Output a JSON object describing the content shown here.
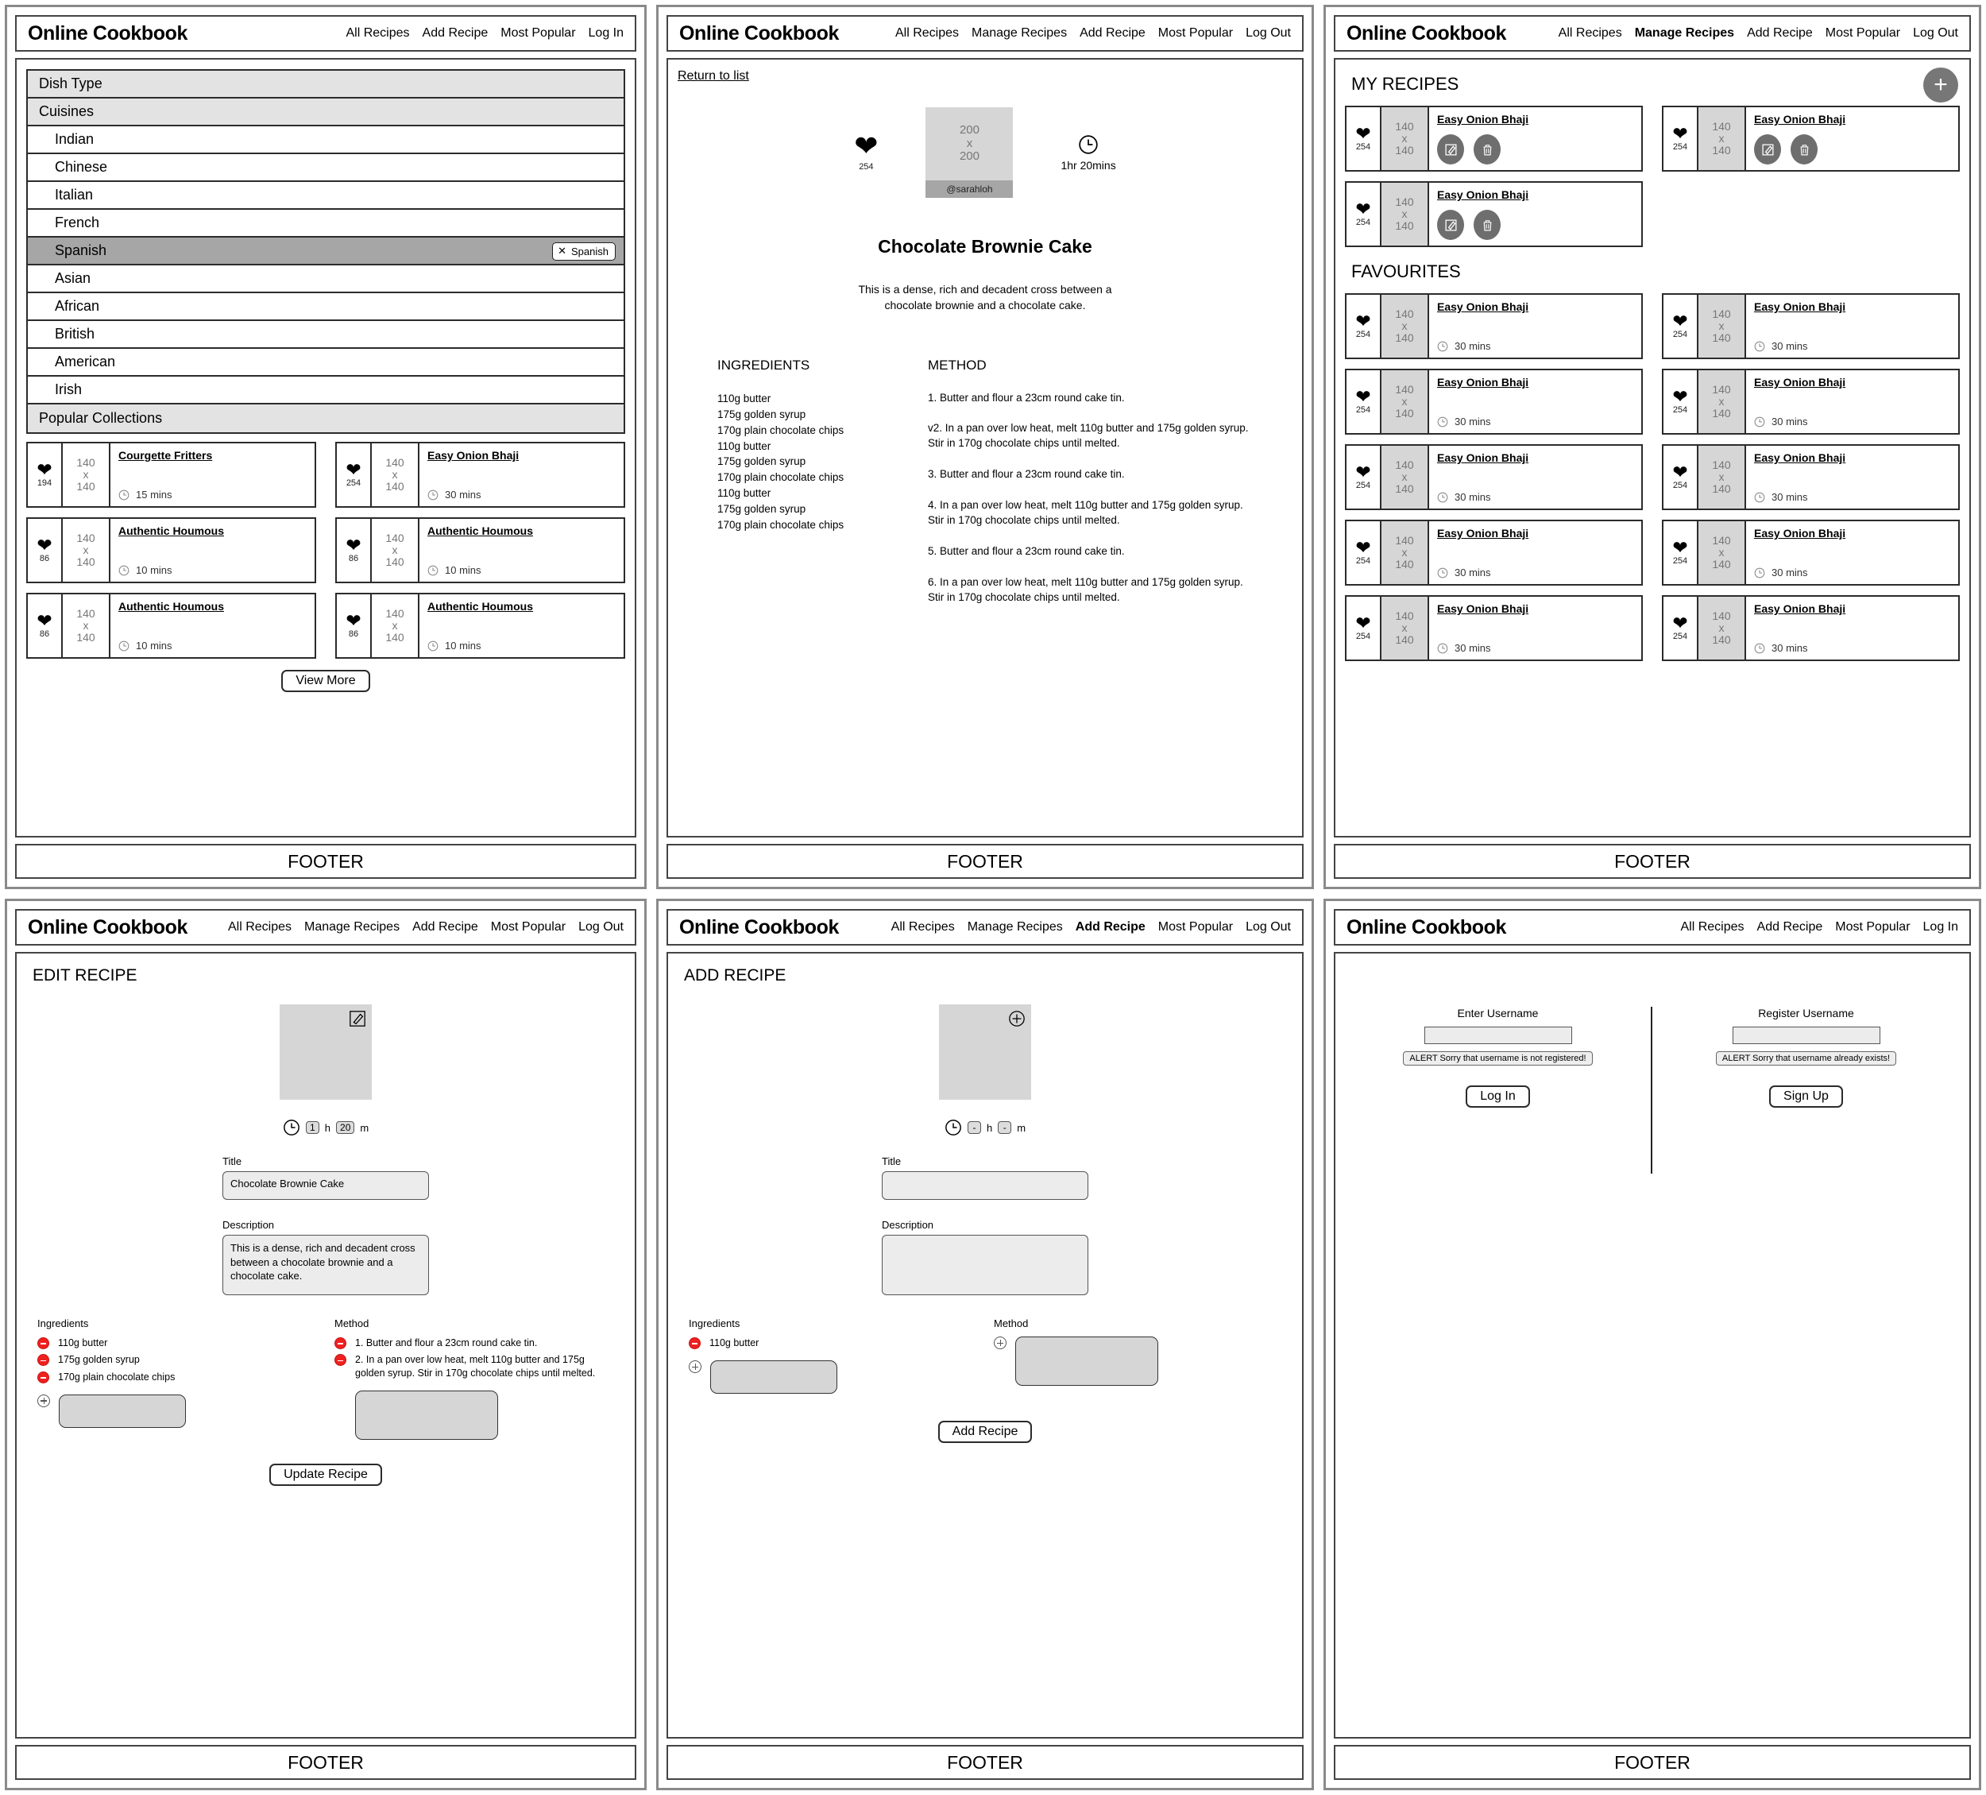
{
  "brand": "Online Cookbook",
  "footer_label": "FOOTER",
  "nav": {
    "logged_out": [
      "All Recipes",
      "Add Recipe",
      "Most Popular",
      "Log In"
    ],
    "logged_in": [
      "All Recipes",
      "Manage Recipes",
      "Add Recipe",
      "Most Popular",
      "Log Out"
    ]
  },
  "panel1": {
    "accordion": [
      {
        "label": "Dish Type",
        "type": "group"
      },
      {
        "label": "Cuisines",
        "type": "group"
      },
      {
        "label": "Indian",
        "type": "child"
      },
      {
        "label": "Chinese",
        "type": "child"
      },
      {
        "label": "Italian",
        "type": "child"
      },
      {
        "label": "French",
        "type": "child"
      },
      {
        "label": "Spanish",
        "type": "child",
        "selected": true,
        "chip": "Spanish",
        "chip_x": "✕"
      },
      {
        "label": "Asian",
        "type": "child"
      },
      {
        "label": "African",
        "type": "child"
      },
      {
        "label": "British",
        "type": "child"
      },
      {
        "label": "American",
        "type": "child"
      },
      {
        "label": "Irish",
        "type": "child"
      },
      {
        "label": "Popular Collections",
        "type": "group"
      }
    ],
    "cards": [
      {
        "favs": "194",
        "thumb": [
          "140",
          "x",
          "140"
        ],
        "title": "Courgette Fritters",
        "time": "15 mins"
      },
      {
        "favs": "254",
        "thumb": [
          "140",
          "x",
          "140"
        ],
        "title": "Easy Onion Bhaji",
        "time": "30 mins"
      },
      {
        "favs": "86",
        "thumb": [
          "140",
          "x",
          "140"
        ],
        "title": "Authentic Houmous",
        "time": "10 mins"
      },
      {
        "favs": "86",
        "thumb": [
          "140",
          "x",
          "140"
        ],
        "title": "Authentic Houmous",
        "time": "10 mins"
      },
      {
        "favs": "86",
        "thumb": [
          "140",
          "x",
          "140"
        ],
        "title": "Authentic Houmous",
        "time": "10 mins"
      },
      {
        "favs": "86",
        "thumb": [
          "140",
          "x",
          "140"
        ],
        "title": "Authentic Houmous",
        "time": "10 mins"
      }
    ],
    "view_more": "View More"
  },
  "panel2": {
    "return_link": "Return to list",
    "favs": "254",
    "thumb": [
      "200",
      "x",
      "200"
    ],
    "author": "@sarahloh",
    "total_time": "1hr 20mins",
    "title": "Chocolate Brownie Cake",
    "description": "This is a dense, rich and decadent cross between a chocolate brownie and a chocolate cake.",
    "ingredients_heading": "INGREDIENTS",
    "method_heading": "METHOD",
    "ingredients": [
      "110g butter",
      "175g golden syrup",
      "170g plain chocolate chips",
      "110g butter",
      "175g golden syrup",
      "170g plain chocolate chips",
      "110g butter",
      "175g golden syrup",
      "170g plain chocolate chips"
    ],
    "method": [
      "1. Butter and flour a 23cm round cake tin.",
      "v2. In a pan over low heat, melt 110g butter and 175g golden syrup. Stir in 170g chocolate chips until melted.",
      "3. Butter and flour a 23cm round cake tin.",
      "4. In a pan over low heat, melt 110g butter and 175g golden syrup. Stir in 170g chocolate chips until melted.",
      "5. Butter and flour a 23cm round cake tin.",
      "6. In a pan over low heat, melt 110g butter and 175g golden syrup. Stir in 170g chocolate chips until melted."
    ]
  },
  "panel3": {
    "my_recipes_heading": "MY RECIPES",
    "favourites_heading": "FAVOURITES",
    "add_fab": "+",
    "my_recipes": [
      {
        "favs": "254",
        "thumb": [
          "140",
          "x",
          "140"
        ],
        "title": "Easy Onion Bhaji"
      },
      {
        "favs": "254",
        "thumb": [
          "140",
          "x",
          "140"
        ],
        "title": "Easy Onion Bhaji"
      },
      {
        "favs": "254",
        "thumb": [
          "140",
          "x",
          "140"
        ],
        "title": "Easy Onion Bhaji"
      }
    ],
    "favourites": [
      {
        "favs": "254",
        "thumb": [
          "140",
          "x",
          "140"
        ],
        "title": "Easy Onion Bhaji",
        "time": "30 mins"
      },
      {
        "favs": "254",
        "thumb": [
          "140",
          "x",
          "140"
        ],
        "title": "Easy Onion Bhaji",
        "time": "30 mins"
      },
      {
        "favs": "254",
        "thumb": [
          "140",
          "x",
          "140"
        ],
        "title": "Easy Onion Bhaji",
        "time": "30 mins"
      },
      {
        "favs": "254",
        "thumb": [
          "140",
          "x",
          "140"
        ],
        "title": "Easy Onion Bhaji",
        "time": "30 mins"
      },
      {
        "favs": "254",
        "thumb": [
          "140",
          "x",
          "140"
        ],
        "title": "Easy Onion Bhaji",
        "time": "30 mins"
      },
      {
        "favs": "254",
        "thumb": [
          "140",
          "x",
          "140"
        ],
        "title": "Easy Onion Bhaji",
        "time": "30 mins"
      },
      {
        "favs": "254",
        "thumb": [
          "140",
          "x",
          "140"
        ],
        "title": "Easy Onion Bhaji",
        "time": "30 mins"
      },
      {
        "favs": "254",
        "thumb": [
          "140",
          "x",
          "140"
        ],
        "title": "Easy Onion Bhaji",
        "time": "30 mins"
      },
      {
        "favs": "254",
        "thumb": [
          "140",
          "x",
          "140"
        ],
        "title": "Easy Onion Bhaji",
        "time": "30 mins"
      },
      {
        "favs": "254",
        "thumb": [
          "140",
          "x",
          "140"
        ],
        "title": "Easy Onion Bhaji",
        "time": "30 mins"
      }
    ]
  },
  "panel4": {
    "page_heading": "EDIT RECIPE",
    "hours_value": "1",
    "hours_unit": "h",
    "mins_value": "20",
    "mins_unit": "m",
    "title_label": "Title",
    "title_value": "Chocolate Brownie Cake",
    "desc_label": "Description",
    "desc_value": "This is a dense, rich and decadent cross between a chocolate brownie and a chocolate cake.",
    "ingredients_label": "Ingredients",
    "method_label": "Method",
    "ingredients": [
      "110g butter",
      "175g golden syrup",
      "170g plain chocolate chips"
    ],
    "method": [
      "1. Butter and flour a 23cm round cake tin.",
      "2. In a pan over low heat, melt 110g butter and 175g golden syrup. Stir in 170g chocolate chips until melted."
    ],
    "submit_label": "Update Recipe"
  },
  "panel5": {
    "page_heading": "ADD RECIPE",
    "hours_value": "-",
    "hours_unit": "h",
    "mins_value": "-",
    "mins_unit": "m",
    "title_label": "Title",
    "title_value": "",
    "desc_label": "Description",
    "desc_value": "",
    "ingredients_label": "Ingredients",
    "method_label": "Method",
    "ingredients": [
      "110g butter"
    ],
    "submit_label": "Add Recipe"
  },
  "panel6": {
    "login_label": "Enter Username",
    "login_value": "",
    "login_alert": "ALERT Sorry that username is not registered!",
    "login_button": "Log In",
    "register_label": "Register Username",
    "register_value": "",
    "register_alert": "ALERT Sorry that username already exists!",
    "register_button": "Sign Up"
  },
  "colors": {
    "alert_red": "#ef2020",
    "shade": "#d6d6d6",
    "selected": "#a6a6a6",
    "group": "#e3e3e3"
  }
}
